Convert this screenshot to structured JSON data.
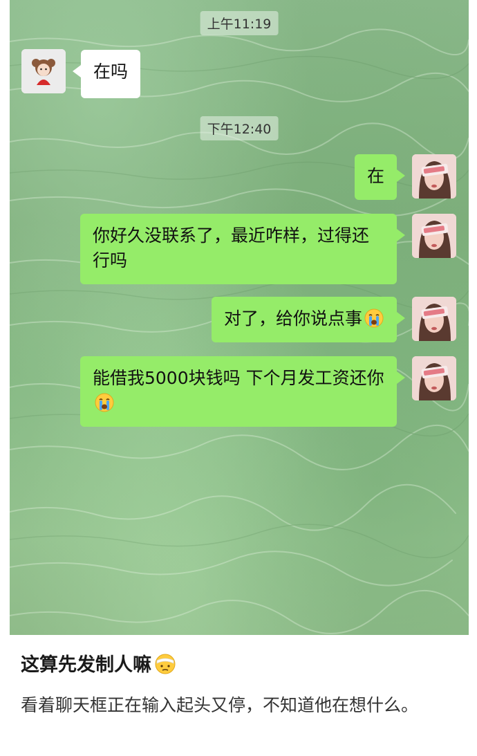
{
  "chat": {
    "timestamps": [
      "上午11:19",
      "下午12:40"
    ],
    "messages": [
      {
        "sender": "contact",
        "text": "在吗"
      },
      {
        "sender": "self",
        "text": "在"
      },
      {
        "sender": "self",
        "text": "你好久没联系了，最近咋样，过得还行吗"
      },
      {
        "sender": "self",
        "text": "对了，给你说点事",
        "emoji": "crying-face"
      },
      {
        "sender": "self",
        "text": "能借我5000块钱吗 下个月发工资还你",
        "emoji": "crying-face"
      }
    ],
    "colors": {
      "self_bubble": "#95ec69",
      "contact_bubble": "#ffffff",
      "background": "#86b884"
    }
  },
  "caption": {
    "title": "这算先发制人嘛",
    "title_emoji": "bandage-face",
    "body": "看着聊天框正在输入起头又停，不知道他在想什么。"
  }
}
